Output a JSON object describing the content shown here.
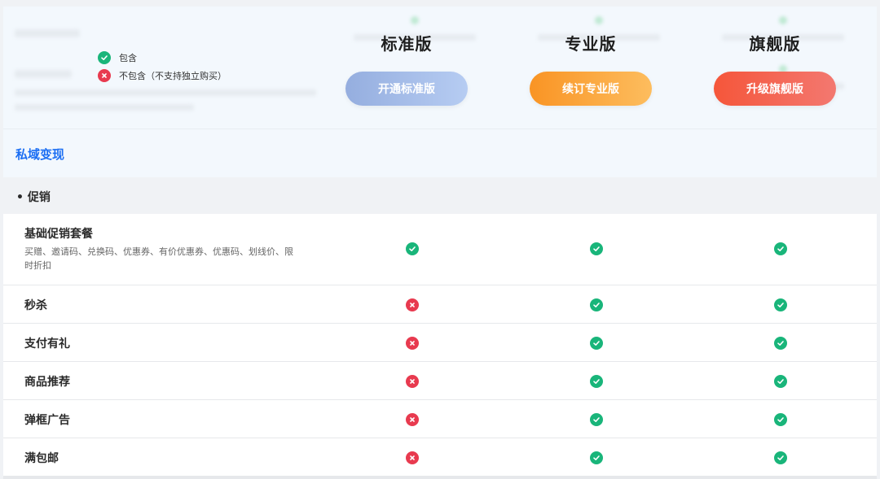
{
  "legend": {
    "included": "包含",
    "not_included": "不包含（不支持独立购买）"
  },
  "plans": [
    {
      "name": "标准版",
      "button": "开通标准版",
      "color_from": "#95aedf",
      "color_to": "#b6ccf2"
    },
    {
      "name": "专业版",
      "button": "续订专业版",
      "color_from": "#f99424",
      "color_to": "#fdbd5e"
    },
    {
      "name": "旗舰版",
      "button": "升级旗舰版",
      "color_from": "#f5563a",
      "color_to": "#f37870"
    }
  ],
  "section": {
    "title": "私域变现",
    "subsection": "• 促销"
  },
  "features": [
    {
      "label": "基础促销套餐",
      "desc": "买赠、邀请码、兑换码、优惠券、有价优惠券、优惠码、划线价、限时折扣",
      "values": [
        true,
        true,
        true
      ]
    },
    {
      "label": "秒杀",
      "desc": "",
      "values": [
        false,
        true,
        true
      ]
    },
    {
      "label": "支付有礼",
      "desc": "",
      "values": [
        false,
        true,
        true
      ]
    },
    {
      "label": "商品推荐",
      "desc": "",
      "values": [
        false,
        true,
        true
      ]
    },
    {
      "label": "弹框广告",
      "desc": "",
      "values": [
        false,
        true,
        true
      ]
    },
    {
      "label": "满包邮",
      "desc": "",
      "values": [
        false,
        true,
        true
      ]
    }
  ],
  "colors": {
    "yes": "#19b57a",
    "no": "#e83a4f",
    "accent": "#1b6ef3"
  }
}
